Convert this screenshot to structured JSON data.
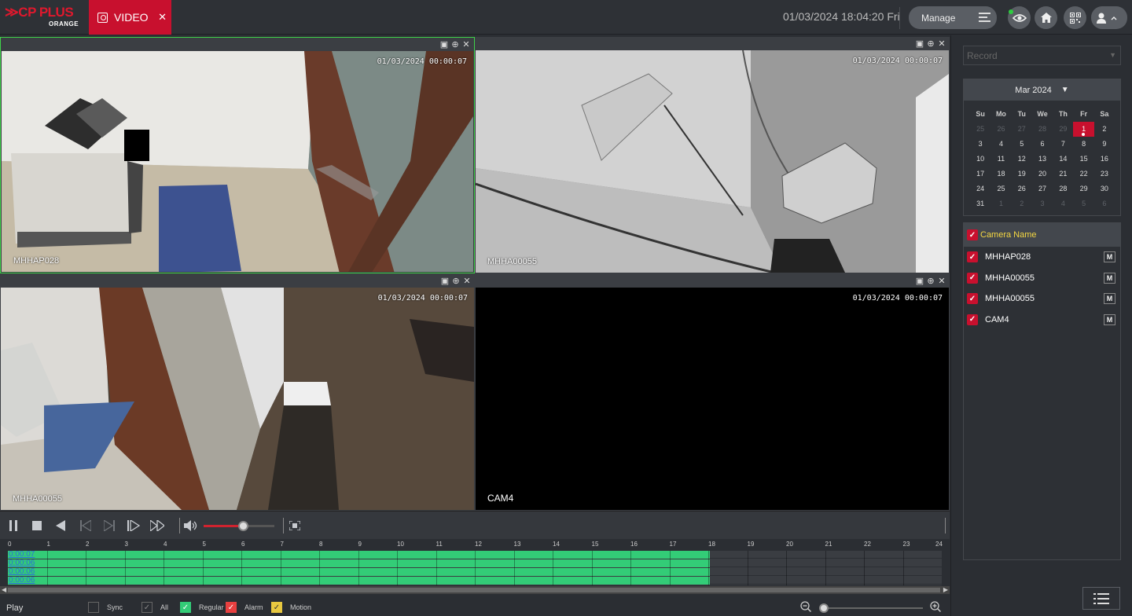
{
  "header": {
    "logo_text": "CP PLUS",
    "logo_sub": "ORANGE",
    "tab_label": "VIDEO",
    "tab_close": "✕",
    "datetime": "01/03/2024 18:04:20 Fri",
    "manage_label": "Manage"
  },
  "cells": [
    {
      "name": "MHHAP028",
      "stamp": "01/03/2024 00:00:07"
    },
    {
      "name": "MHHA00055",
      "stamp": "01/03/2024 00:00:07"
    },
    {
      "name": "MHHA00055",
      "stamp": "01/03/2024 00:00:07"
    },
    {
      "name": "CAM4",
      "stamp": "01/03/2024 00:00:07"
    }
  ],
  "playback": {
    "volume_level": 0.55
  },
  "timeline": {
    "hours": [
      "0",
      "1",
      "2",
      "3",
      "4",
      "5",
      "6",
      "7",
      "8",
      "9",
      "10",
      "11",
      "12",
      "13",
      "14",
      "15",
      "16",
      "17",
      "18",
      "19",
      "20",
      "21",
      "22",
      "23",
      "24"
    ],
    "tracks": [
      {
        "time": "0:00:07",
        "recorded_until_hour": 18.05
      },
      {
        "time": "0:00:06",
        "recorded_until_hour": 18.05
      },
      {
        "time": "0:00:06",
        "recorded_until_hour": 18.05
      },
      {
        "time": "0:00:06",
        "recorded_until_hour": 18.05
      }
    ]
  },
  "bottom": {
    "play_label": "Play",
    "sync_label": "Sync",
    "all_label": "All",
    "regular_label": "Regular",
    "alarm_label": "Alarm",
    "motion_label": "Motion",
    "zoom_level": 0.0
  },
  "colors": {
    "brand_red": "#c8102e",
    "regular": "#33cc77",
    "alarm": "#e84040",
    "motion": "#e8c840",
    "selected_border": "#3fd24a"
  },
  "sidebar": {
    "record_placeholder": "Record",
    "calendar": {
      "month_label": "Mar 2024",
      "weekdays": [
        "Su",
        "Mo",
        "Tu",
        "We",
        "Th",
        "Fr",
        "Sa"
      ],
      "days": [
        {
          "d": "25",
          "m": true
        },
        {
          "d": "26",
          "m": true
        },
        {
          "d": "27",
          "m": true
        },
        {
          "d": "28",
          "m": true
        },
        {
          "d": "29",
          "m": true
        },
        {
          "d": "1",
          "sel": true
        },
        {
          "d": "2"
        },
        {
          "d": "3"
        },
        {
          "d": "4"
        },
        {
          "d": "5"
        },
        {
          "d": "6"
        },
        {
          "d": "7"
        },
        {
          "d": "8"
        },
        {
          "d": "9"
        },
        {
          "d": "10"
        },
        {
          "d": "11"
        },
        {
          "d": "12"
        },
        {
          "d": "13"
        },
        {
          "d": "14"
        },
        {
          "d": "15"
        },
        {
          "d": "16"
        },
        {
          "d": "17"
        },
        {
          "d": "18"
        },
        {
          "d": "19"
        },
        {
          "d": "20"
        },
        {
          "d": "21"
        },
        {
          "d": "22"
        },
        {
          "d": "23"
        },
        {
          "d": "24"
        },
        {
          "d": "25"
        },
        {
          "d": "26"
        },
        {
          "d": "27"
        },
        {
          "d": "28"
        },
        {
          "d": "29"
        },
        {
          "d": "30"
        },
        {
          "d": "31"
        },
        {
          "d": "1",
          "m": true
        },
        {
          "d": "2",
          "m": true
        },
        {
          "d": "3",
          "m": true
        },
        {
          "d": "4",
          "m": true
        },
        {
          "d": "5",
          "m": true
        },
        {
          "d": "6",
          "m": true
        }
      ]
    },
    "camera_header": "Camera Name",
    "cameras": [
      {
        "name": "MHHAP028",
        "badge": "M"
      },
      {
        "name": "MHHA00055",
        "badge": "M"
      },
      {
        "name": "MHHA00055",
        "badge": "M"
      },
      {
        "name": "CAM4",
        "badge": "M"
      }
    ]
  }
}
